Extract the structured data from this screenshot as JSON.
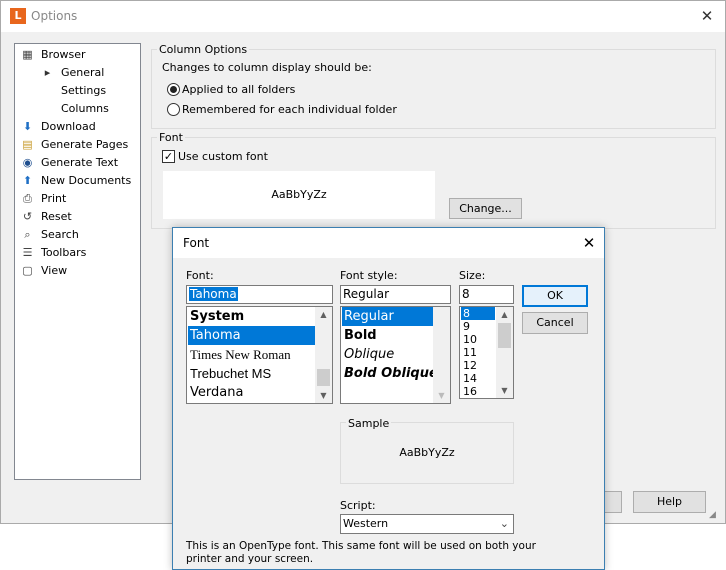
{
  "window": {
    "app_icon_letter": "L",
    "title": "Options",
    "close_glyph": "✕"
  },
  "tree": {
    "items": [
      {
        "label": "Browser",
        "icon": "browser-icon",
        "indent": 0
      },
      {
        "label": "General",
        "icon": "arrow-right-icon",
        "indent": 1
      },
      {
        "label": "Settings",
        "icon": "",
        "indent": 1
      },
      {
        "label": "Columns",
        "icon": "",
        "indent": 1
      },
      {
        "label": "Download",
        "icon": "download-icon",
        "indent": 0
      },
      {
        "label": "Generate Pages",
        "icon": "generate-pages-icon",
        "indent": 0
      },
      {
        "label": "Generate Text",
        "icon": "generate-text-icon",
        "indent": 0
      },
      {
        "label": "New Documents",
        "icon": "new-documents-icon",
        "indent": 0
      },
      {
        "label": "Print",
        "icon": "print-icon",
        "indent": 0
      },
      {
        "label": "Reset",
        "icon": "reset-icon",
        "indent": 0
      },
      {
        "label": "Search",
        "icon": "search-icon",
        "indent": 0
      },
      {
        "label": "Toolbars",
        "icon": "toolbars-icon",
        "indent": 0
      },
      {
        "label": "View",
        "icon": "view-icon",
        "indent": 0
      }
    ]
  },
  "column_options": {
    "group_label": "Column Options",
    "description": "Changes to column display should be:",
    "option_all": "Applied to all folders",
    "option_each": "Remembered for each individual folder",
    "selected": "all"
  },
  "font_group": {
    "group_label": "Font",
    "custom_font_label": "Use custom font",
    "custom_font_checked": true,
    "preview_text": "AaBbYyZz",
    "change_button": "Change..."
  },
  "main_buttons": {
    "help": "Help"
  },
  "font_dialog": {
    "title": "Font",
    "close_glyph": "✕",
    "font_label": "Font:",
    "font_value": "Tahoma",
    "font_list": [
      "System",
      "Tahoma",
      "Times New Roman",
      "Trebuchet MS",
      "Verdana"
    ],
    "font_selected": "Tahoma",
    "style_label": "Font style:",
    "style_value": "Regular",
    "style_list": [
      "Regular",
      "Bold",
      "Oblique",
      "Bold Oblique"
    ],
    "style_selected": "Regular",
    "size_label": "Size:",
    "size_value": "8",
    "size_list": [
      "8",
      "9",
      "10",
      "11",
      "12",
      "14",
      "16"
    ],
    "size_selected": "8",
    "ok_button": "OK",
    "cancel_button": "Cancel",
    "sample_label": "Sample",
    "sample_text": "AaBbYyZz",
    "script_label": "Script:",
    "script_value": "Western",
    "info_text": "This is an OpenType font. This same font will be used on both your printer and your screen."
  },
  "colors": {
    "selection": "#0078d7",
    "app_icon": "#e8661d",
    "dialog_border": "#3c7fb1"
  }
}
